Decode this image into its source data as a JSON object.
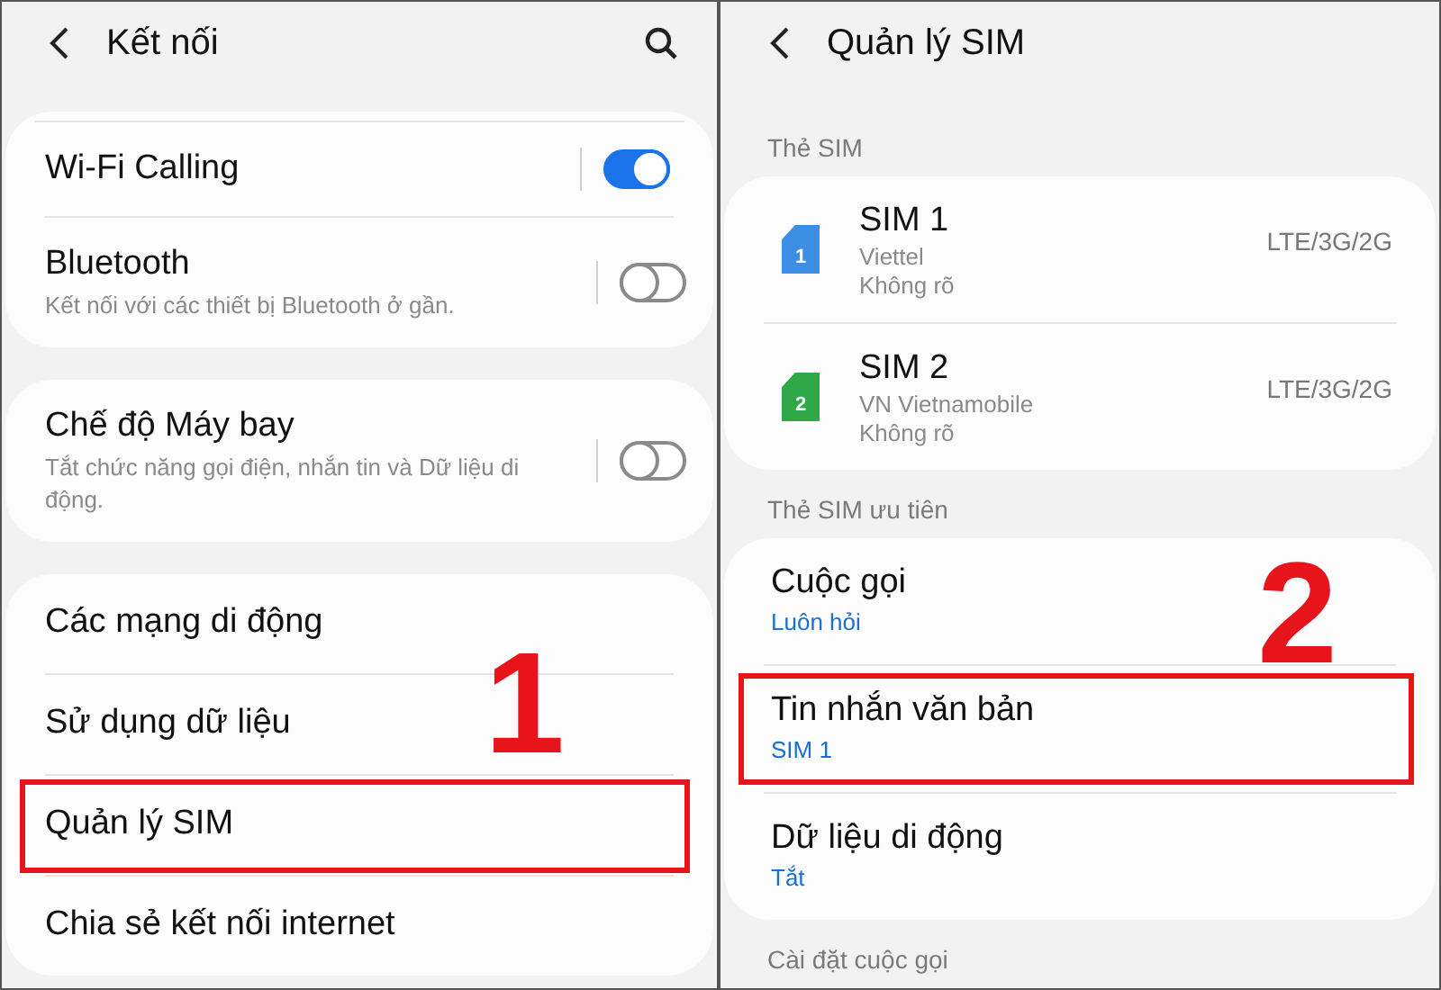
{
  "left": {
    "title": "Kết nối",
    "step_number": "1",
    "cards": [
      {
        "items": [
          {
            "kind": "toggle",
            "label": "Wi-Fi Calling",
            "on": true
          },
          {
            "kind": "toggle",
            "label": "Bluetooth",
            "description": "Kết nối với các thiết bị Bluetooth ở gần.",
            "on": false
          }
        ]
      },
      {
        "items": [
          {
            "kind": "toggle",
            "label": "Chế độ Máy bay",
            "description": "Tắt chức năng gọi điện, nhắn tin và Dữ liệu di động.",
            "on": false
          }
        ]
      },
      {
        "items": [
          {
            "kind": "link",
            "label": "Các mạng di động",
            "highlighted": false
          },
          {
            "kind": "link",
            "label": "Sử dụng dữ liệu",
            "highlighted": false
          },
          {
            "kind": "link",
            "label": "Quản lý SIM",
            "highlighted": true
          },
          {
            "kind": "link",
            "label": "Chia sẻ kết nối internet",
            "highlighted": false
          }
        ]
      }
    ]
  },
  "right": {
    "title": "Quản lý SIM",
    "step_number": "2",
    "sections": [
      {
        "header": "Thẻ SIM",
        "items": [
          {
            "kind": "sim",
            "label": "SIM 1",
            "slot": "1",
            "carrier": "Viettel",
            "status": "Không rõ",
            "network": "LTE/3G/2G",
            "color": "#3d8fe6"
          },
          {
            "kind": "sim",
            "label": "SIM 2",
            "slot": "2",
            "carrier": "VN Vietnamobile",
            "status": "Không rõ",
            "network": "LTE/3G/2G",
            "color": "#2fa84a"
          }
        ]
      },
      {
        "header": "Thẻ SIM ưu tiên",
        "items": [
          {
            "kind": "pref",
            "label": "Cuộc gọi",
            "value": "Luôn hỏi",
            "highlighted": false
          },
          {
            "kind": "pref",
            "label": "Tin nhắn văn bản",
            "value": "SIM 1",
            "highlighted": true
          },
          {
            "kind": "pref",
            "label": "Dữ liệu di động",
            "value": "Tắt",
            "highlighted": false
          }
        ]
      },
      {
        "header": "Cài đặt cuộc gọi"
      }
    ]
  }
}
